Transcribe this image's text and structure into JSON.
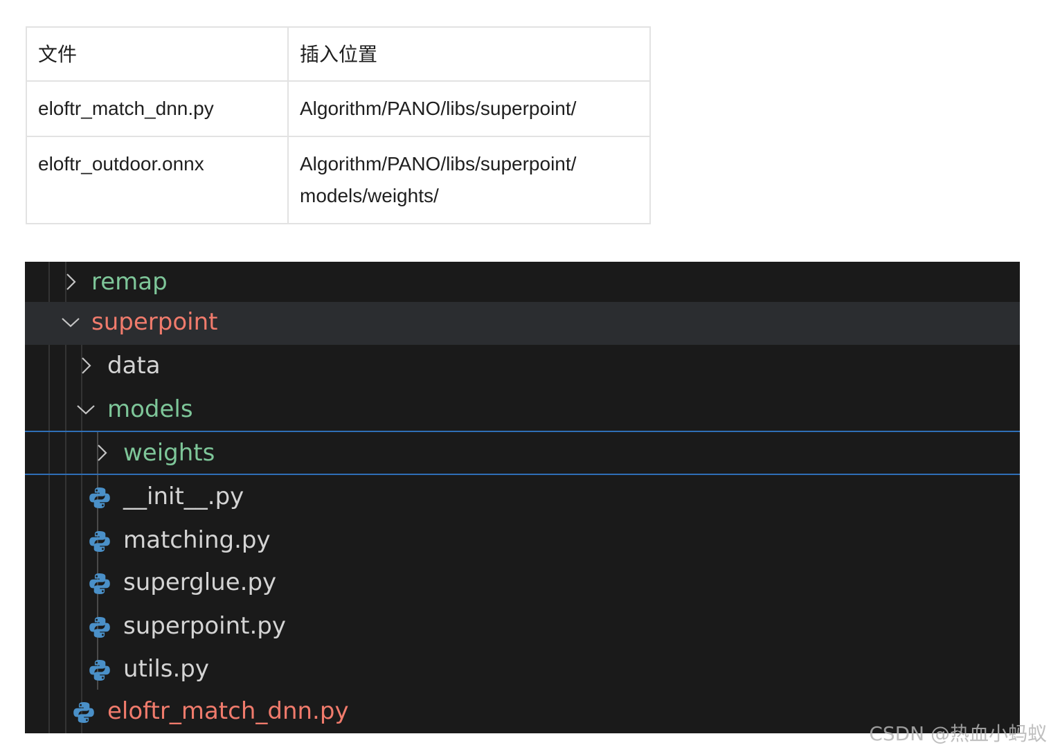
{
  "table": {
    "header": {
      "file": "文件",
      "location": "插入位置"
    },
    "rows": [
      {
        "file": "eloftr_match_dnn.py",
        "location_lines": [
          "Algorithm/PANO/libs/superpoint/"
        ]
      },
      {
        "file": "eloftr_outdoor.onnx",
        "location_lines": [
          "Algorithm/PANO/libs/superpoint/",
          "models/weights/"
        ]
      }
    ]
  },
  "explorer": {
    "colors": {
      "background": "#1a1a1a",
      "folder_green": "#7ec699",
      "modified_red": "#f07b6c",
      "text": "#d4d4d4",
      "focus_border": "#2f6fb7"
    },
    "items": [
      {
        "label": "remap",
        "type": "folder",
        "state": "collapsed",
        "icon": "chevron-right-icon"
      },
      {
        "label": "superpoint",
        "type": "folder",
        "state": "expanded",
        "icon": "chevron-down-icon"
      },
      {
        "label": "data",
        "type": "folder",
        "state": "collapsed",
        "icon": "chevron-right-icon"
      },
      {
        "label": "models",
        "type": "folder",
        "state": "expanded",
        "icon": "chevron-down-icon"
      },
      {
        "label": "weights",
        "type": "folder",
        "state": "collapsed",
        "icon": "chevron-right-icon"
      },
      {
        "label": "__init__.py",
        "type": "file",
        "icon": "python-icon"
      },
      {
        "label": "matching.py",
        "type": "file",
        "icon": "python-icon"
      },
      {
        "label": "superglue.py",
        "type": "file",
        "icon": "python-icon"
      },
      {
        "label": "superpoint.py",
        "type": "file",
        "icon": "python-icon"
      },
      {
        "label": "utils.py",
        "type": "file",
        "icon": "python-icon"
      },
      {
        "label": "eloftr_match_dnn.py",
        "type": "file",
        "icon": "python-icon"
      }
    ]
  },
  "watermark": "CSDN @热血小蚂蚁"
}
